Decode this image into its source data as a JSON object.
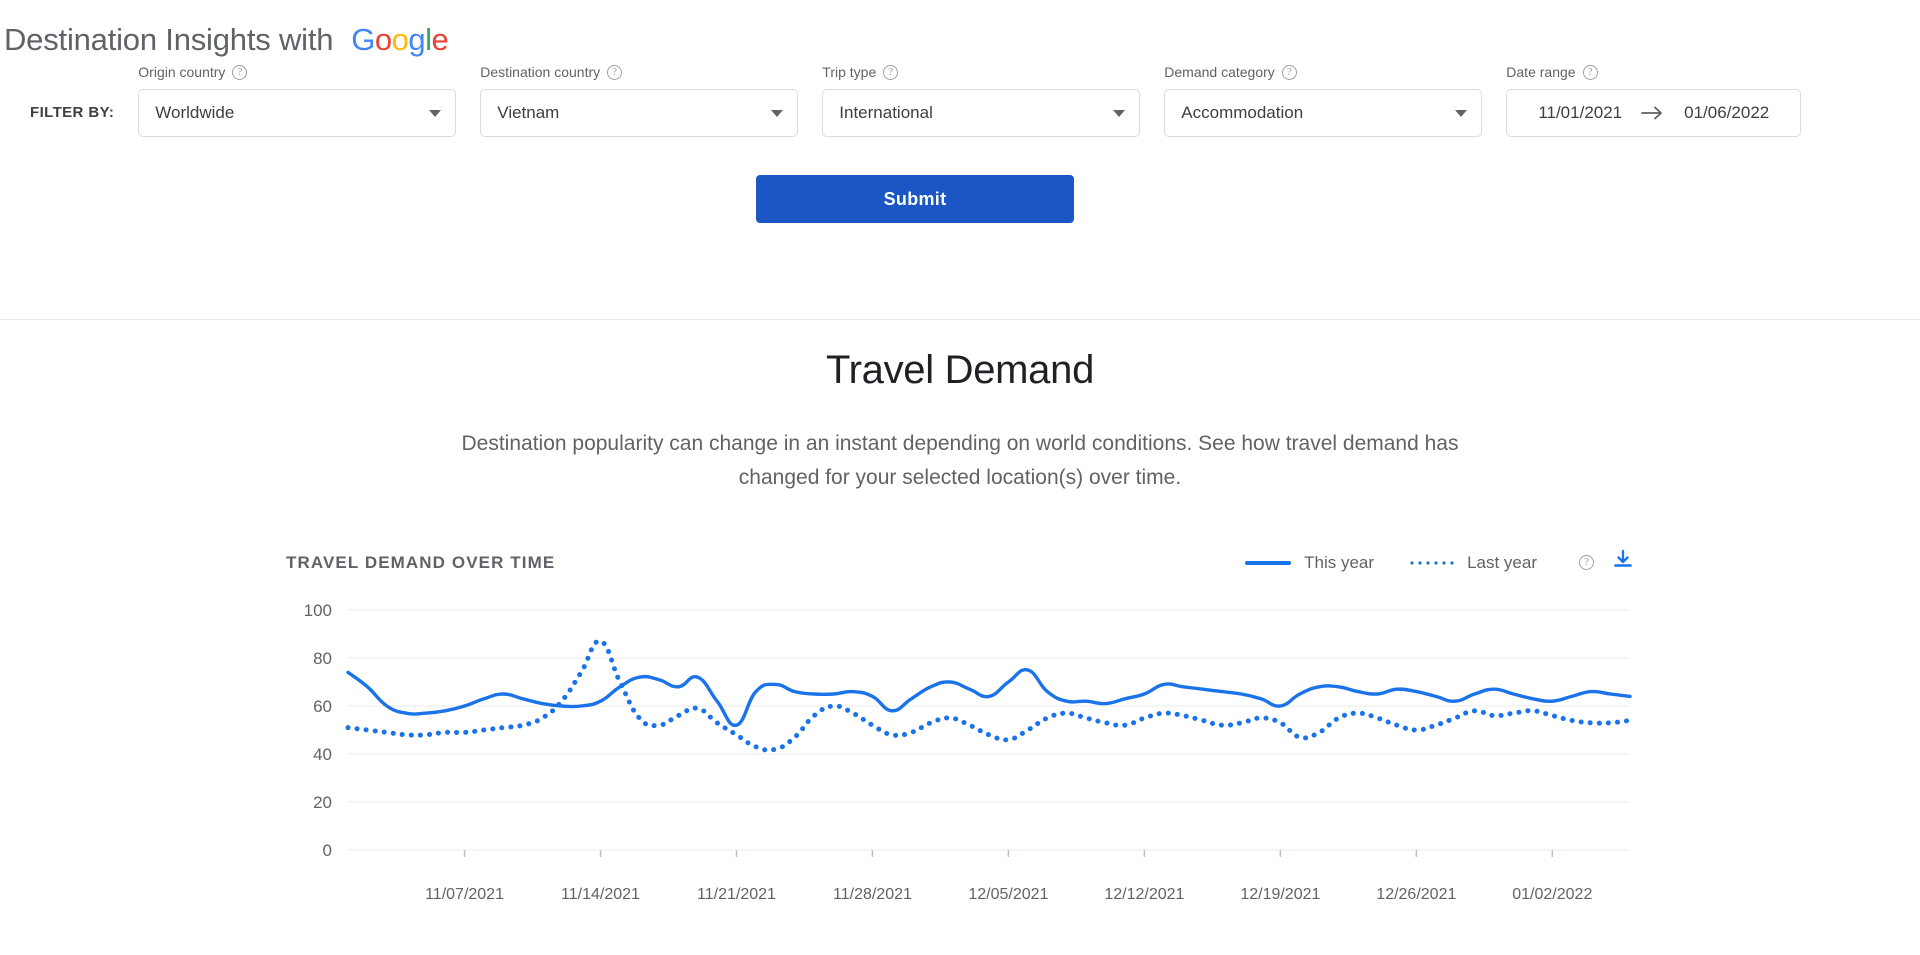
{
  "header": {
    "title": "Destination Insights with",
    "brand": "Google",
    "brand_letters": [
      {
        "ch": "G",
        "color": "#4285F4"
      },
      {
        "ch": "o",
        "color": "#EA4335"
      },
      {
        "ch": "o",
        "color": "#FBBC05"
      },
      {
        "ch": "g",
        "color": "#4285F4"
      },
      {
        "ch": "l",
        "color": "#34A853"
      },
      {
        "ch": "e",
        "color": "#EA4335"
      }
    ]
  },
  "filters": {
    "filter_by_label": "FILTER BY:",
    "fields": [
      {
        "label": "Origin country",
        "value": "Worldwide",
        "help": "help-icon",
        "name": "origin-country"
      },
      {
        "label": "Destination country",
        "value": "Vietnam",
        "help": "help-icon",
        "name": "destination-country"
      },
      {
        "label": "Trip type",
        "value": "International",
        "help": "help-icon",
        "name": "trip-type"
      },
      {
        "label": "Demand category",
        "value": "Accommodation",
        "help": "help-icon",
        "name": "demand-category"
      }
    ],
    "date_range": {
      "label": "Date range",
      "start": "11/01/2021",
      "end": "01/06/2022",
      "separator_icon": "arrow-right-icon"
    },
    "submit_label": "Submit",
    "submit_color": "#1a56c4"
  },
  "main": {
    "section_title": "Travel Demand",
    "section_description": "Destination popularity can change in an instant depending on world conditions. See how travel demand has changed for your selected location(s) over time."
  },
  "chart_panel": {
    "title": "TRAVEL DEMAND OVER TIME",
    "legend": [
      {
        "label": "This year",
        "style": "solid",
        "color": "#1a73e8"
      },
      {
        "label": "Last year",
        "style": "dotted",
        "color": "#1a73e8"
      }
    ],
    "help_icon": "help-icon",
    "download_icon": "download-icon"
  },
  "chart_data": {
    "type": "line",
    "title": "TRAVEL DEMAND OVER TIME",
    "xlabel": "",
    "ylabel": "",
    "ylim": [
      0,
      100
    ],
    "yticks": [
      0,
      20,
      40,
      60,
      80,
      100
    ],
    "grid": true,
    "legend_position": "top-right",
    "x_tick_labels": [
      "11/07/2021",
      "11/14/2021",
      "11/21/2021",
      "11/28/2021",
      "12/05/2021",
      "12/12/2021",
      "12/19/2021",
      "12/26/2021",
      "01/02/2022"
    ],
    "x_tick_indices": [
      6,
      13,
      20,
      27,
      34,
      41,
      48,
      55,
      62
    ],
    "x_range": [
      "11/01/2021",
      "01/06/2022"
    ],
    "n_points": 67,
    "series": [
      {
        "name": "This year",
        "style": "solid",
        "color": "#1a73e8",
        "values": [
          74,
          68,
          60,
          57,
          57,
          58,
          60,
          63,
          65,
          63,
          61,
          60,
          60,
          62,
          68,
          72,
          71,
          68,
          72,
          62,
          52,
          66,
          69,
          66,
          65,
          65,
          66,
          64,
          58,
          63,
          68,
          70,
          67,
          64,
          70,
          75,
          66,
          62,
          62,
          61,
          63,
          65,
          69,
          68,
          67,
          66,
          65,
          63,
          60,
          65,
          68,
          68,
          66,
          65,
          67,
          66,
          64,
          62,
          65,
          67,
          65,
          63,
          62,
          64,
          66,
          65,
          64
        ]
      },
      {
        "name": "Last year",
        "style": "dotted",
        "color": "#1a73e8",
        "values": [
          51,
          50,
          49,
          48,
          48,
          49,
          49,
          50,
          51,
          52,
          55,
          62,
          74,
          87,
          70,
          55,
          52,
          56,
          59,
          53,
          48,
          43,
          42,
          47,
          56,
          60,
          57,
          52,
          48,
          49,
          53,
          55,
          52,
          48,
          46,
          50,
          55,
          57,
          55,
          53,
          52,
          55,
          57,
          56,
          54,
          52,
          53,
          55,
          53,
          47,
          49,
          55,
          57,
          55,
          52,
          50,
          52,
          55,
          58,
          56,
          57,
          58,
          56,
          54,
          53,
          53,
          54
        ]
      }
    ]
  }
}
